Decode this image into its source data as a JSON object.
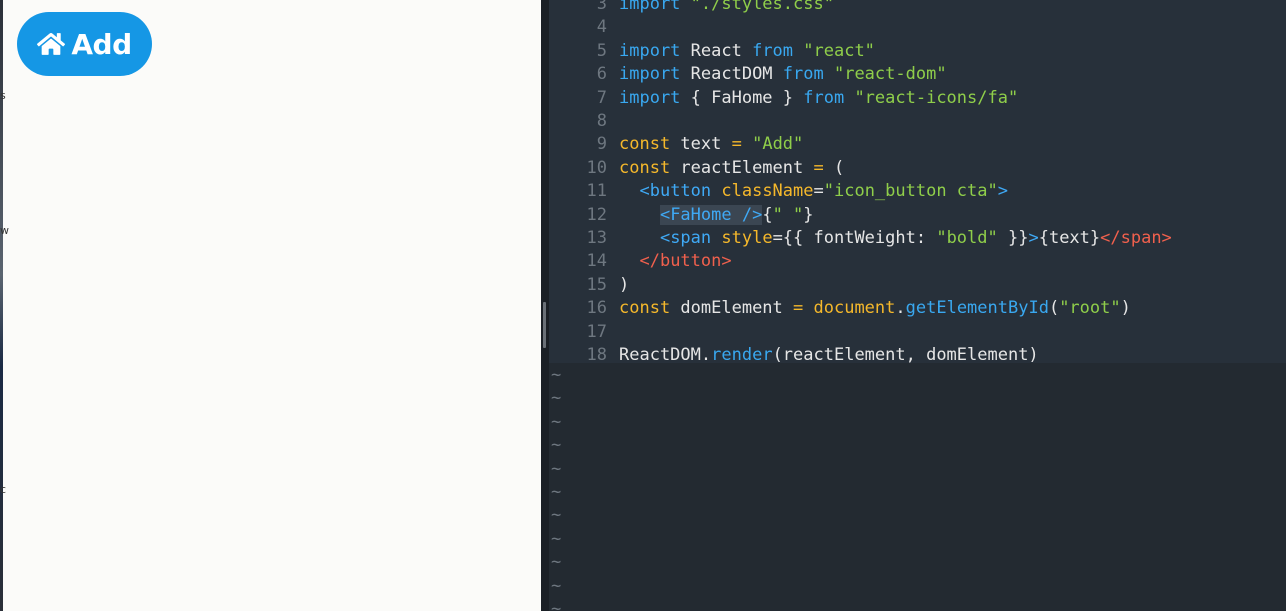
{
  "preview": {
    "button": {
      "icon": "home-icon",
      "label": "Add",
      "color": "#1597e5"
    },
    "edge_glyphs": [
      "s",
      "w",
      "c"
    ]
  },
  "editor": {
    "lines": [
      {
        "num": "3",
        "segments": [
          {
            "t": "import ",
            "c": "kw2"
          },
          {
            "t": "\"./styles.css\"",
            "c": "str"
          }
        ]
      },
      {
        "num": "4",
        "segments": []
      },
      {
        "num": "5",
        "segments": [
          {
            "t": "import ",
            "c": "kw2"
          },
          {
            "t": "React ",
            "c": "plain"
          },
          {
            "t": "from ",
            "c": "kw2"
          },
          {
            "t": "\"react\"",
            "c": "str"
          }
        ]
      },
      {
        "num": "6",
        "segments": [
          {
            "t": "import ",
            "c": "kw2"
          },
          {
            "t": "ReactDOM ",
            "c": "plain"
          },
          {
            "t": "from ",
            "c": "kw2"
          },
          {
            "t": "\"react-dom\"",
            "c": "str"
          }
        ]
      },
      {
        "num": "7",
        "segments": [
          {
            "t": "import ",
            "c": "kw2"
          },
          {
            "t": "{ FaHome } ",
            "c": "plain"
          },
          {
            "t": "from ",
            "c": "kw2"
          },
          {
            "t": "\"react-icons/fa\"",
            "c": "str"
          }
        ]
      },
      {
        "num": "8",
        "segments": []
      },
      {
        "num": "9",
        "segments": [
          {
            "t": "const ",
            "c": "kw"
          },
          {
            "t": "text ",
            "c": "plain"
          },
          {
            "t": "= ",
            "c": "op"
          },
          {
            "t": "\"Add\"",
            "c": "str"
          }
        ]
      },
      {
        "num": "10",
        "segments": [
          {
            "t": "const ",
            "c": "kw"
          },
          {
            "t": "reactElement ",
            "c": "plain"
          },
          {
            "t": "= ",
            "c": "op"
          },
          {
            "t": "(",
            "c": "plain"
          }
        ]
      },
      {
        "num": "11",
        "segments": [
          {
            "t": "  ",
            "c": "plain"
          },
          {
            "t": "<button ",
            "c": "tag"
          },
          {
            "t": "className",
            "c": "attr"
          },
          {
            "t": "=",
            "c": "plain"
          },
          {
            "t": "\"icon_button cta\"",
            "c": "str"
          },
          {
            "t": ">",
            "c": "tag"
          }
        ]
      },
      {
        "num": "12",
        "segments": [
          {
            "t": "    ",
            "c": "plain"
          },
          {
            "t": "<FaHome />",
            "c": "tag",
            "hl": true
          },
          {
            "t": "{",
            "c": "plain"
          },
          {
            "t": "\" \"",
            "c": "str"
          },
          {
            "t": "}",
            "c": "plain"
          }
        ]
      },
      {
        "num": "13",
        "segments": [
          {
            "t": "    ",
            "c": "plain"
          },
          {
            "t": "<span ",
            "c": "tag"
          },
          {
            "t": "style",
            "c": "attr"
          },
          {
            "t": "={{ fontWeight: ",
            "c": "plain"
          },
          {
            "t": "\"bold\"",
            "c": "str"
          },
          {
            "t": " }}",
            "c": "plain"
          },
          {
            "t": ">",
            "c": "tag"
          },
          {
            "t": "{text}",
            "c": "plain"
          },
          {
            "t": "</span>",
            "c": "ctag"
          }
        ]
      },
      {
        "num": "14",
        "segments": [
          {
            "t": "  ",
            "c": "plain"
          },
          {
            "t": "</button>",
            "c": "ctag"
          }
        ]
      },
      {
        "num": "15",
        "segments": [
          {
            "t": ")",
            "c": "plain"
          }
        ]
      },
      {
        "num": "16",
        "segments": [
          {
            "t": "const ",
            "c": "kw"
          },
          {
            "t": "domElement ",
            "c": "plain"
          },
          {
            "t": "= ",
            "c": "op"
          },
          {
            "t": "document",
            "c": "kw"
          },
          {
            "t": ".",
            "c": "plain"
          },
          {
            "t": "getElementById",
            "c": "fn"
          },
          {
            "t": "(",
            "c": "plain"
          },
          {
            "t": "\"root\"",
            "c": "str"
          },
          {
            "t": ")",
            "c": "plain"
          }
        ]
      },
      {
        "num": "17",
        "segments": []
      },
      {
        "num": "18",
        "segments": [
          {
            "t": "ReactDOM",
            "c": "plain"
          },
          {
            "t": ".",
            "c": "plain"
          },
          {
            "t": "render",
            "c": "fn"
          },
          {
            "t": "(reactElement, domElement)",
            "c": "plain"
          }
        ]
      }
    ],
    "tilde": "~",
    "tilde_count": 11
  }
}
